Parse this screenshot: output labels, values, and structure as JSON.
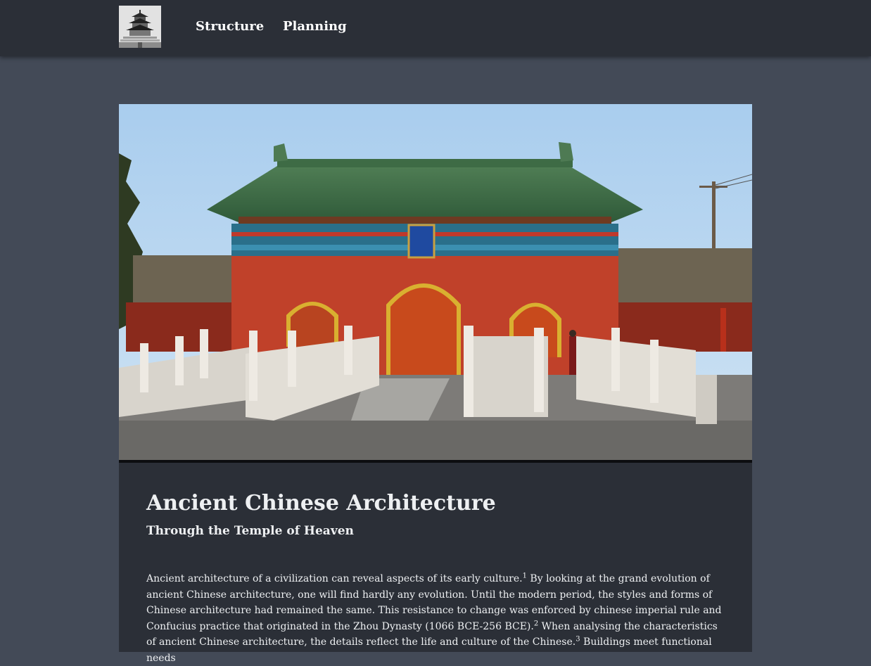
{
  "nav": {
    "logo_alt": "Temple of Heaven",
    "links": [
      "Structure",
      "Planning"
    ]
  },
  "hero": {
    "alt": "Temple of Heaven gate"
  },
  "article": {
    "title": "Ancient Chinese Architecture",
    "subtitle": "Through the Temple of Heaven",
    "segments": [
      "Ancient architecture of a civilization can reveal aspects of its early culture.",
      "1",
      " By looking at the grand evolution of ancient Chinese architecture, one will find hardly any evolution. Until the modern period, the styles and forms of Chinese architecture had remained the same. This resistance to change was enforced by chinese imperial rule and Confucius practice that originated in the Zhou Dynasty (1066 BCE-256 BCE).",
      "2",
      " When analysing the characteristics of ancient Chinese architecture, the details reflect the life and culture of the Chinese.",
      "3",
      " Buildings meet functional needs"
    ]
  },
  "colors": {
    "page_bg": "#434a57",
    "navbar_bg": "#2b2f37",
    "card_bg": "#2b2f37",
    "text": "#eef0f2"
  }
}
